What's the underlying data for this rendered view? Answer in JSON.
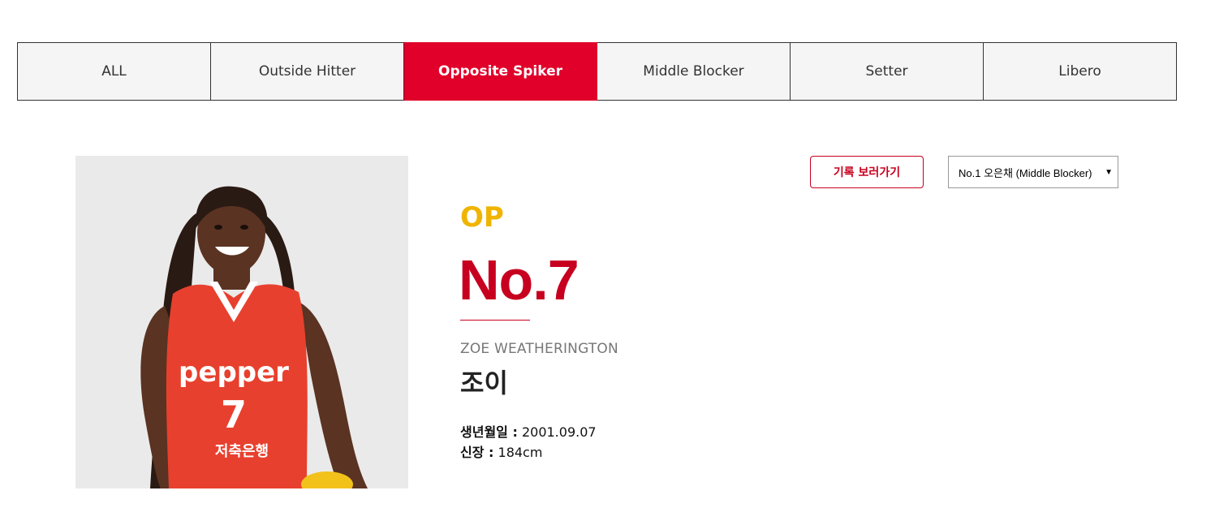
{
  "tabs": [
    {
      "label": "ALL",
      "active": false
    },
    {
      "label": "Outside Hitter",
      "active": false
    },
    {
      "label": "Opposite Spiker",
      "active": true
    },
    {
      "label": "Middle Blocker",
      "active": false
    },
    {
      "label": "Setter",
      "active": false
    },
    {
      "label": "Libero",
      "active": false
    }
  ],
  "player": {
    "position_code": "OP",
    "number": "No.7",
    "name_en": "ZOE WEATHERINGTON",
    "name_ko": "조이",
    "birth_label": "생년월일 :",
    "birth_value": "2001.09.07",
    "height_label": "신장 :",
    "height_value": "184cm",
    "jersey_brand": "pepper",
    "jersey_number": "7",
    "jersey_sponsor": "저축은행"
  },
  "controls": {
    "record_button": "기록 보러가기",
    "player_select_value": "No.1 오은채 (Middle Blocker)"
  },
  "colors": {
    "accent_red": "#e0002a",
    "number_red": "#c7001f",
    "position_yellow": "#f0b400"
  }
}
